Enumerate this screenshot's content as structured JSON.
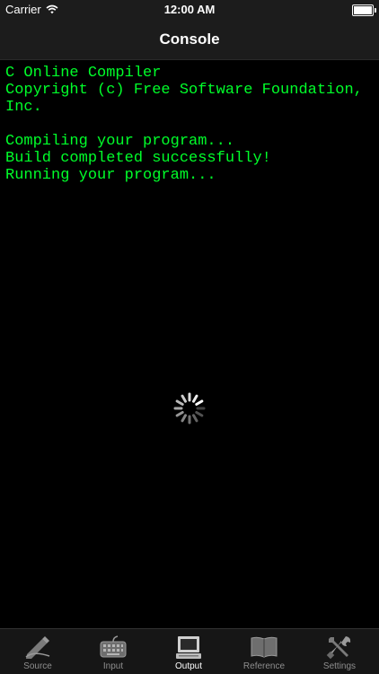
{
  "status_bar": {
    "carrier": "Carrier",
    "time": "12:00 AM",
    "battery_level": 1.0
  },
  "nav": {
    "title": "Console"
  },
  "console": {
    "lines": [
      "C Online Compiler",
      "Copyright (c) Free Software Foundation, Inc.",
      "",
      "Compiling your program...",
      "Build completed successfully!",
      "Running your program..."
    ]
  },
  "loading_icon": "spinner-icon",
  "tabs": [
    {
      "label": "Source",
      "icon": "pen-icon",
      "active": false
    },
    {
      "label": "Input",
      "icon": "keyboard-icon",
      "active": false
    },
    {
      "label": "Output",
      "icon": "monitor-icon",
      "active": true
    },
    {
      "label": "Reference",
      "icon": "book-icon",
      "active": false
    },
    {
      "label": "Settings",
      "icon": "tools-icon",
      "active": false
    }
  ],
  "colors": {
    "console_text": "#00ff2a",
    "background": "#000000",
    "bar": "#1c1c1c",
    "tab_inactive": "#8e8e8e",
    "tab_active": "#ffffff"
  }
}
